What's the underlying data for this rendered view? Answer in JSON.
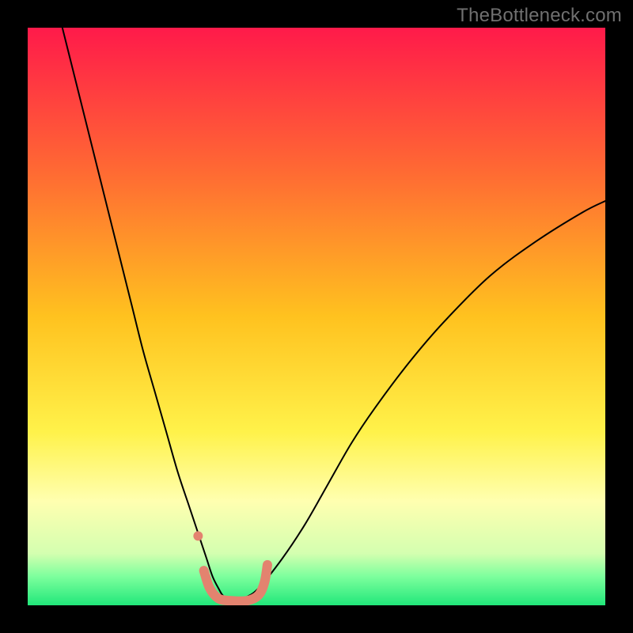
{
  "watermark": "TheBottleneck.com",
  "chart_data": {
    "type": "line",
    "title": "",
    "xlabel": "",
    "ylabel": "",
    "xlim": [
      0,
      100
    ],
    "ylim": [
      0,
      100
    ],
    "grid": false,
    "legend": false,
    "background": {
      "style": "vertical-gradient",
      "stops": [
        {
          "y": 0,
          "color": "#ff1a4a"
        },
        {
          "y": 25,
          "color": "#ff6a33"
        },
        {
          "y": 50,
          "color": "#ffc21f"
        },
        {
          "y": 70,
          "color": "#fff24a"
        },
        {
          "y": 82,
          "color": "#ffffb0"
        },
        {
          "y": 91,
          "color": "#d4ffb0"
        },
        {
          "y": 95,
          "color": "#7dff9d"
        },
        {
          "y": 100,
          "color": "#21e77a"
        }
      ]
    },
    "series": [
      {
        "name": "bottleneck-curve",
        "stroke": "#000000",
        "stroke_width": 2,
        "x": [
          6,
          8,
          10,
          12,
          14,
          16,
          18,
          20,
          22,
          24,
          26,
          28,
          30,
          31,
          32,
          33,
          34,
          36,
          38,
          40,
          44,
          48,
          52,
          56,
          60,
          66,
          72,
          80,
          88,
          96,
          100
        ],
        "y": [
          100,
          92,
          84,
          76,
          68,
          60,
          52,
          44,
          37,
          30,
          23,
          17,
          11,
          8,
          5,
          3,
          1.5,
          0.8,
          1.5,
          3,
          8,
          14,
          21,
          28,
          34,
          42,
          49,
          57,
          63,
          68,
          70
        ]
      },
      {
        "name": "highlight-band",
        "stroke": "#e3836f",
        "stroke_width": 12,
        "x": [
          30.5,
          31.5,
          33,
          35,
          38,
          40,
          41,
          41.5
        ],
        "y": [
          6,
          3,
          1.2,
          0.8,
          0.8,
          1.8,
          4,
          7
        ]
      },
      {
        "name": "highlight-dot",
        "type": "scatter",
        "color": "#e3836f",
        "radius": 6,
        "x": [
          29.5
        ],
        "y": [
          12
        ]
      }
    ]
  }
}
